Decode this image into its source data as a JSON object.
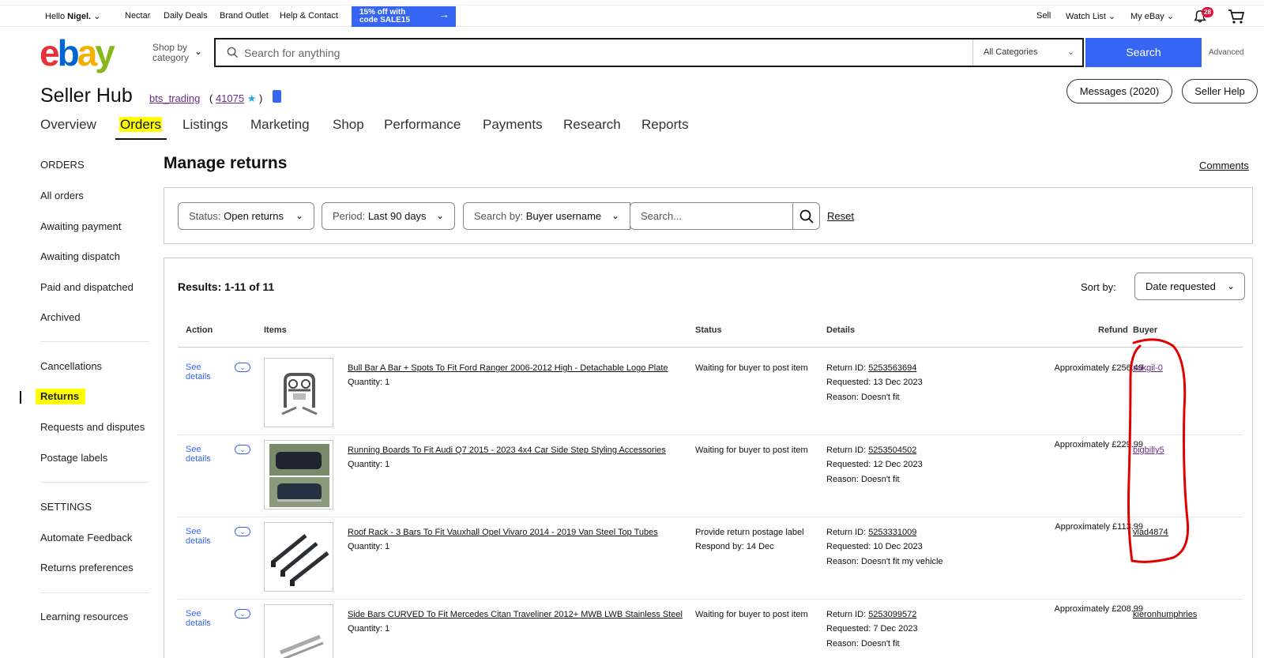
{
  "topbar": {
    "greeting": "Hello",
    "user": "Nigel.",
    "links": [
      "Nectar",
      "Daily Deals",
      "Brand Outlet",
      "Help & Contact"
    ],
    "promo_line1": "15% off with",
    "promo_line2": "code SALE15",
    "right_links": [
      "Sell",
      "Watch List",
      "My eBay"
    ],
    "notification_count": "28"
  },
  "header": {
    "logo": [
      "e",
      "b",
      "a",
      "y"
    ],
    "shop_by_line1": "Shop by",
    "shop_by_line2": "category",
    "search_placeholder": "Search for anything",
    "category": "All Categories",
    "search_button": "Search",
    "advanced": "Advanced"
  },
  "hub": {
    "title": "Seller Hub",
    "username": "bts_trading",
    "score": "41075",
    "messages_button": "Messages (2020)",
    "help_button": "Seller Help",
    "tabs": [
      "Overview",
      "Orders",
      "Listings",
      "Marketing",
      "Shop",
      "Performance",
      "Payments",
      "Research",
      "Reports"
    ]
  },
  "sidebar": {
    "orders_heading": "ORDERS",
    "orders_items": [
      "All orders",
      "Awaiting payment",
      "Awaiting dispatch",
      "Paid and dispatched",
      "Archived"
    ],
    "returns_items": [
      "Cancellations",
      "Returns",
      "Requests and disputes",
      "Postage labels"
    ],
    "settings_heading": "SETTINGS",
    "settings_items": [
      "Automate Feedback",
      "Returns preferences"
    ],
    "learning": "Learning resources"
  },
  "main": {
    "title": "Manage returns",
    "comments": "Comments",
    "filters": {
      "status_key": "Status:",
      "status_val": "Open returns",
      "period_key": "Period:",
      "period_val": "Last 90 days",
      "searchby_key": "Search by:",
      "searchby_val": "Buyer username",
      "search_placeholder": "Search...",
      "reset": "Reset"
    },
    "results_count": "Results: 1-11 of 11",
    "sort_label": "Sort by:",
    "sort_value": "Date requested",
    "columns": [
      "Action",
      "Items",
      "Status",
      "Details",
      "Refund",
      "Buyer"
    ],
    "rows": [
      {
        "see": "See details",
        "title": "Bull Bar A Bar + Spots To Fit Ford Ranger 2006-2012 High - Detachable Logo Plate",
        "qty": "Quantity: 1",
        "status": "Waiting for buyer to post item",
        "status2": "",
        "return_id_label": "Return ID: ",
        "return_id": "5253563694",
        "requested": "Requested: 13 Dec 2023",
        "reason": "Reason: Doesn't fit",
        "refund": "Approximately £256.49",
        "buyer": "sakgil-0"
      },
      {
        "see": "See details",
        "title": "Running Boards To Fit Audi Q7 2015 - 2023 4x4 Car Side Step Styling Accessories",
        "qty": "Quantity: 1",
        "status": "Waiting for buyer to post item",
        "status2": "",
        "return_id_label": "Return ID: ",
        "return_id": "5253504502",
        "requested": "Requested: 12 Dec 2023",
        "reason": "Reason: Doesn't fit",
        "refund": "Approximately £229.99",
        "buyer": "bigbilly5"
      },
      {
        "see": "See details",
        "title": "Roof Rack - 3 Bars To Fit Vauxhall Opel Vivaro 2014 - 2019 Van Steel Top Tubes",
        "qty": "Quantity: 1",
        "status": "Provide return postage label",
        "status2": "Respond by: 14 Dec",
        "return_id_label": "Return ID: ",
        "return_id": "5253331009",
        "requested": "Requested: 10 Dec 2023",
        "reason": "Reason: Doesn't fit my vehicle",
        "refund": "Approximately £113.99",
        "buyer": "vlad4874"
      },
      {
        "see": "See details",
        "title": "Side Bars CURVED To Fit Mercedes Citan Traveliner 2012+ MWB LWB Stainless Steel",
        "qty": "Quantity: 1",
        "status": "Waiting for buyer to post item",
        "status2": "",
        "return_id_label": "Return ID: ",
        "return_id": "5253099572",
        "requested": "Requested: 7 Dec 2023",
        "reason": "Reason: Doesn't fit",
        "refund": "Approximately £208.99",
        "buyer": "kieronhumphries"
      }
    ]
  },
  "colors": {
    "accent": "#3665f3",
    "highlight": "#ffff00",
    "annotation": "#e00000",
    "visited_link": "#6b2a8c"
  }
}
